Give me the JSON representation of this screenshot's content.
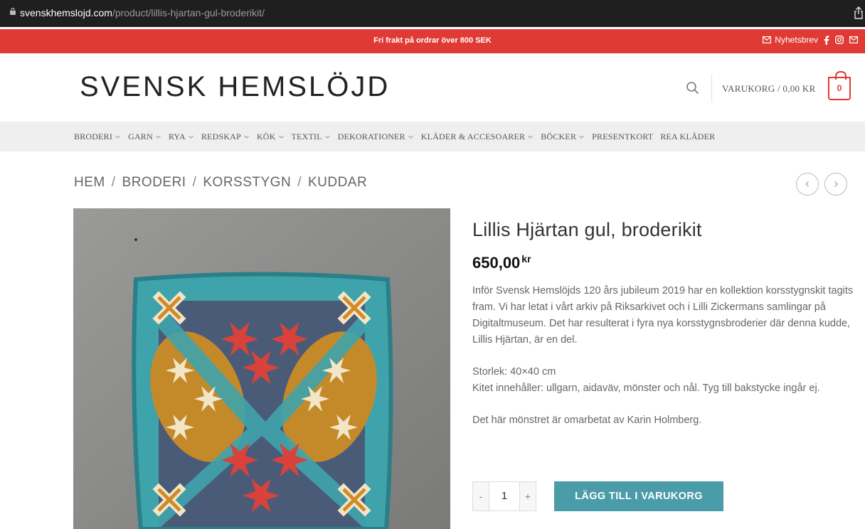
{
  "browser": {
    "url_domain": "svenskhemslojd.com",
    "url_path": "/product/lillis-hjartan-gul-broderikit/"
  },
  "topbar": {
    "promo": "Fri frakt på ordrar över 800 SEK",
    "newsletter": "Nyhetsbrev",
    "color": "#e03a35"
  },
  "header": {
    "logo": "SVENSK HEMSLÖJD",
    "cart_label": "VARUKORG / 0,00 KR",
    "cart_count": "0"
  },
  "nav": {
    "items": [
      {
        "label": "BRODERI",
        "dropdown": true
      },
      {
        "label": "GARN",
        "dropdown": true
      },
      {
        "label": "RYA",
        "dropdown": true
      },
      {
        "label": "REDSKAP",
        "dropdown": true
      },
      {
        "label": "KÖK",
        "dropdown": true
      },
      {
        "label": "TEXTIL",
        "dropdown": true
      },
      {
        "label": "DEKORATIONER",
        "dropdown": true
      },
      {
        "label": "KLÄDER & ACCESOARER",
        "dropdown": true
      },
      {
        "label": "BÖCKER",
        "dropdown": true
      },
      {
        "label": "PRESENTKORT",
        "dropdown": false
      },
      {
        "label": "REA KLÄDER",
        "dropdown": false
      }
    ]
  },
  "breadcrumb": [
    "HEM",
    "BRODERI",
    "KORSSTYGN",
    "KUDDAR"
  ],
  "product": {
    "title": "Lillis Hjärtan gul, broderikit",
    "price": "650,00",
    "currency": "kr",
    "description": [
      "Inför Svensk Hemslöjds 120 års jubileum 2019 har en kollektion korsstygnskit tagits fram. Vi har letat i vårt arkiv på Riksarkivet och i Lilli Zickermans samlingar på Digitaltmuseum. Det har resulterat i fyra nya korsstygnsbroderier där denna kudde, Lillis Hjärtan, är en del.",
      "Storlek: 40×40 cm",
      "Kitet innehåller: ullgarn, aidaväv, mönster och nål. Tyg till bakstycke ingår ej.",
      "Det här mönstret är omarbetat av Karin Holmberg."
    ],
    "quantity": "1",
    "minus_label": "-",
    "plus_label": "+",
    "add_to_cart": "LÄGG TILL I VARUKORG",
    "button_color": "#4a9ca8"
  }
}
